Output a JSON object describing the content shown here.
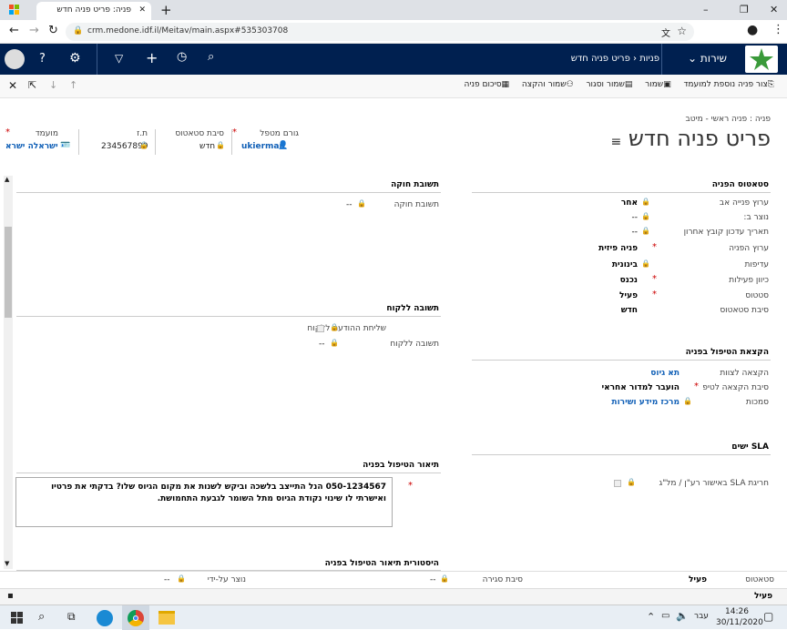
{
  "browser": {
    "tab_title": "פניה: פריט פניה חדש",
    "new_tab": "+",
    "url": "crm.medone.idf.il/Meitav/main.aspx#535303708",
    "min": "–",
    "max": "❐",
    "close": "✕",
    "tab_close": "✕"
  },
  "nav": {
    "app": "שירות",
    "section": "פניות",
    "record": "פריט פניה חדש",
    "help": "?"
  },
  "commands": [
    {
      "icon": "copy-icon",
      "label": "צור פניה נוספת למועמד"
    },
    {
      "icon": "save-icon",
      "label": "שמור"
    },
    {
      "icon": "save-close-icon",
      "label": "שמור וסגור"
    },
    {
      "icon": "save-assign-icon",
      "label": "שמור והקצה"
    },
    {
      "icon": "summary-icon",
      "label": "סיכום פניה"
    }
  ],
  "header": {
    "breadcrumb": "פניה : פניה ראשי - מיטב",
    "title": "פריט פניה חדש",
    "fields": [
      {
        "label": "גורם מטפל",
        "value": "ukierman",
        "link": true,
        "required": true
      },
      {
        "label": "סיבת סטאטוס",
        "value": "חדש",
        "link": false,
        "required": false
      },
      {
        "label": "ת.ז",
        "value": "234567899",
        "link": false,
        "required": false
      },
      {
        "label": "מועמד",
        "value": "ישראלה ישרא",
        "link": true,
        "required": true
      }
    ]
  },
  "status_section": {
    "title": "סטאטוס הפניה",
    "rows": [
      {
        "label": "ערוץ פנייה אב",
        "value": "אחר",
        "lock": true,
        "req": false
      },
      {
        "label": "נוצר ב:",
        "value": "--",
        "lock": true,
        "req": false
      },
      {
        "label": "תאריך עדכון קובץ אחרון",
        "value": "--",
        "lock": true,
        "req": false
      },
      {
        "label": "ערוץ הפניה",
        "value": "פניה פיזית",
        "lock": false,
        "req": true
      },
      {
        "label": "עדיפות",
        "value": "בינונית",
        "lock": true,
        "req": false
      },
      {
        "label": "כיוון פעילות",
        "value": "נכנס",
        "lock": false,
        "req": true
      },
      {
        "label": "סטטוס",
        "value": "פעיל",
        "lock": false,
        "req": true
      },
      {
        "label": "סיבת סטאטוס",
        "value": "חדש",
        "lock": false,
        "req": false
      }
    ]
  },
  "assign_section": {
    "title": "הקצאת הטיפול בפניה",
    "rows": [
      {
        "label": "הקצאה לצוות",
        "value": "תא גיוס",
        "link": true,
        "lock": false,
        "req": false
      },
      {
        "label": "סיבת הקצאה לטיפ",
        "value": "הועבר למדור אחראי",
        "link": false,
        "lock": false,
        "req": true
      },
      {
        "label": "סמכות",
        "value": "מרכז מידע ושירות",
        "link": true,
        "lock": true,
        "req": false
      }
    ]
  },
  "sla_section": {
    "title": "SLA ישים",
    "label": "חריגת SLA באישור רע\"ן / מל\"ג"
  },
  "reply_section": {
    "title": "תשובת חוקה",
    "label": "תשובת חוקה",
    "value": "--"
  },
  "client_section": {
    "title": "תשובה ללקוח",
    "rows": [
      {
        "label": "שליחת ההודעה ללקוח",
        "value": ""
      },
      {
        "label": "תשובה ללקוח",
        "value": "--"
      }
    ]
  },
  "description": {
    "title": "תיאור הטיפול בפניה",
    "text": "050-1234567 הנל התייצב בלשכה וביקש לשנות את מקום הגיוס שלו? בדקתי את פרטיו ואישרתי לו שינוי נקודת הגיוס מתל השומר לגבעת התחמושת."
  },
  "history_title": "היסטורית תיאור הטיפול בפניה",
  "footer": {
    "status_label": "סטאטוס",
    "status_value": "פעיל",
    "close_reason_label": "סיבת סגירה",
    "close_reason_value": "--",
    "created_by_label": "נוצר על-ידי",
    "created_by_value": "--",
    "bottom_status": "פעיל"
  },
  "taskbar": {
    "time": "14:26",
    "date": "30/11/2020",
    "lang": "עבר"
  }
}
